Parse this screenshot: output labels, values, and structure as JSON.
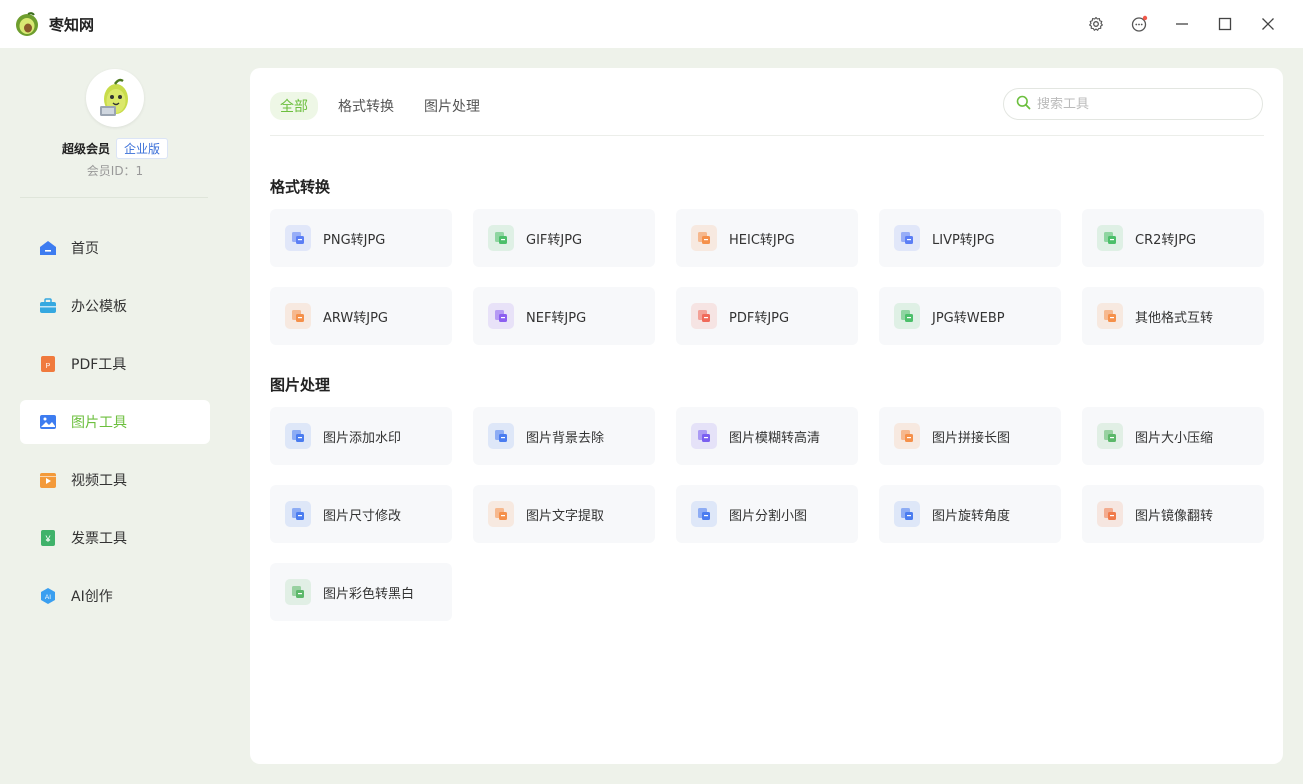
{
  "app": {
    "title": "枣知网"
  },
  "window_controls": [
    "gear-icon",
    "message-icon",
    "minimize-icon",
    "maximize-icon",
    "close-icon"
  ],
  "user": {
    "name": "超级会员",
    "badge": "企业版",
    "member_id": "会员ID：1"
  },
  "nav": [
    {
      "label": "首页",
      "icon": "home-icon",
      "color": "#3d7cf0",
      "active": false
    },
    {
      "label": "办公模板",
      "icon": "briefcase-icon",
      "color": "#35a8e0",
      "active": false
    },
    {
      "label": "PDF工具",
      "icon": "pdf-icon",
      "color": "#f07a3d",
      "active": false
    },
    {
      "label": "图片工具",
      "icon": "image-icon",
      "color": "#3d7cf0",
      "active": true
    },
    {
      "label": "视频工具",
      "icon": "video-icon",
      "color": "#f39a3a",
      "active": false
    },
    {
      "label": "发票工具",
      "icon": "invoice-icon",
      "color": "#3fb26a",
      "active": false
    },
    {
      "label": "AI创作",
      "icon": "ai-icon",
      "color": "#3a9ff0",
      "active": false
    }
  ],
  "tabs": [
    {
      "label": "全部",
      "active": true
    },
    {
      "label": "格式转换",
      "active": false
    },
    {
      "label": "图片处理",
      "active": false
    }
  ],
  "search": {
    "placeholder": "搜索工具"
  },
  "sections": [
    {
      "title": "格式转换",
      "items": [
        {
          "label": "PNG转JPG",
          "icon": "png-to-jpg-icon",
          "color": "#5b7ef5"
        },
        {
          "label": "GIF转JPG",
          "icon": "gif-to-jpg-icon",
          "color": "#4cbf6a"
        },
        {
          "label": "HEIC转JPG",
          "icon": "heic-to-jpg-icon",
          "color": "#f5904a"
        },
        {
          "label": "LIVP转JPG",
          "icon": "livp-to-jpg-icon",
          "color": "#5b7ef5"
        },
        {
          "label": "CR2转JPG",
          "icon": "cr2-to-jpg-icon",
          "color": "#4cbf6a"
        },
        {
          "label": "ARW转JPG",
          "icon": "arw-to-jpg-icon",
          "color": "#f5904a"
        },
        {
          "label": "NEF转JPG",
          "icon": "nef-to-jpg-icon",
          "color": "#8b5ff0"
        },
        {
          "label": "PDF转JPG",
          "icon": "pdf-to-jpg-icon",
          "color": "#f06a5a"
        },
        {
          "label": "JPG转WEBP",
          "icon": "jpg-to-webp-icon",
          "color": "#4cbf6a"
        },
        {
          "label": "其他格式互转",
          "icon": "format-convert-icon",
          "color": "#f5904a"
        }
      ]
    },
    {
      "title": "图片处理",
      "items": [
        {
          "label": "图片添加水印",
          "icon": "watermark-icon",
          "color": "#4a7cf0"
        },
        {
          "label": "图片背景去除",
          "icon": "remove-background-icon",
          "color": "#4a7cf0"
        },
        {
          "label": "图片模糊转高清",
          "icon": "enhance-icon",
          "color": "#7a5ff0"
        },
        {
          "label": "图片拼接长图",
          "icon": "stitch-icon",
          "color": "#f5904a"
        },
        {
          "label": "图片大小压缩",
          "icon": "compress-icon",
          "color": "#5cb86a"
        },
        {
          "label": "图片尺寸修改",
          "icon": "resize-icon",
          "color": "#4a7cf0"
        },
        {
          "label": "图片文字提取",
          "icon": "ocr-icon",
          "color": "#f5904a"
        },
        {
          "label": "图片分割小图",
          "icon": "split-icon",
          "color": "#4a7cf0"
        },
        {
          "label": "图片旋转角度",
          "icon": "rotate-icon",
          "color": "#4a7cf0"
        },
        {
          "label": "图片镜像翻转",
          "icon": "mirror-icon",
          "color": "#f07a4a"
        },
        {
          "label": "图片彩色转黑白",
          "icon": "grayscale-icon",
          "color": "#5cb86a"
        }
      ]
    }
  ]
}
